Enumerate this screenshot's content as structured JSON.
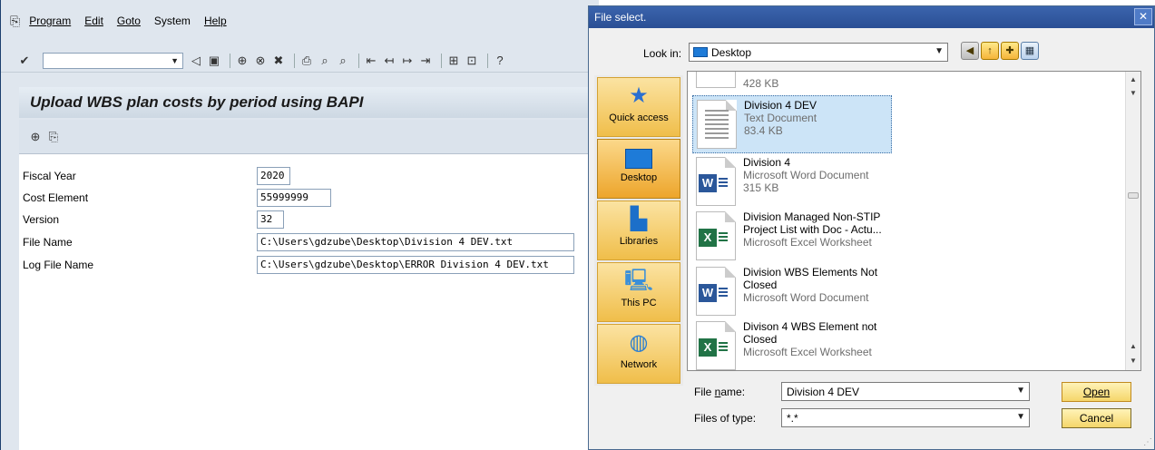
{
  "sap": {
    "menu": [
      "Program",
      "Edit",
      "Goto",
      "System",
      "Help"
    ],
    "title": "Upload WBS plan costs by period using BAPI",
    "fields": [
      {
        "label": "Fiscal Year",
        "value": "2020"
      },
      {
        "label": "Cost Element",
        "value": "55999999"
      },
      {
        "label": "Version",
        "value": "32"
      },
      {
        "label": "File Name",
        "value": "C:\\Users\\gdzube\\Desktop\\Division 4 DEV.txt"
      },
      {
        "label": "Log File Name",
        "value": "C:\\Users\\gdzube\\Desktop\\ERROR Division 4 DEV.txt"
      }
    ],
    "toolbar_icons": [
      "enter-icon",
      "back-icon",
      "save-icon",
      "exit-icon",
      "cancel-icon",
      "print-icon",
      "find-icon",
      "find-next-icon",
      "help-icon"
    ]
  },
  "dialog": {
    "title": "File select.",
    "close": "✕",
    "look_in_label": "Look in:",
    "look_in_value": "Desktop",
    "places": [
      "Quick access",
      "Desktop",
      "Libraries",
      "This PC",
      "Network"
    ],
    "files": [
      {
        "name": "",
        "type": "",
        "size": "428 KB",
        "icon": "text"
      },
      {
        "name": "Division 4 DEV",
        "type": "Text Document",
        "size": "83.4 KB",
        "icon": "text"
      },
      {
        "name": "Division 4",
        "type": "Microsoft Word Document",
        "size": "315 KB",
        "icon": "word"
      },
      {
        "name": "Division Managed Non-STIP Project List with Doc - Actu...",
        "type": "Microsoft Excel Worksheet",
        "size": "",
        "icon": "excel"
      },
      {
        "name": "Division WBS Elements Not Closed",
        "type": "Microsoft Word Document",
        "size": "",
        "icon": "word"
      },
      {
        "name": "Divison 4 WBS Element not Closed",
        "type": "Microsoft Excel Worksheet",
        "size": "",
        "icon": "excel"
      }
    ],
    "file_name_label": "File name:",
    "file_name_value": "Division 4 DEV",
    "file_type_label": "Files of type:",
    "file_type_value": "*.*",
    "open_label": "Open",
    "cancel_label": "Cancel"
  },
  "colors": {
    "sap_bg": "#dfe6ee",
    "dialog_title": "#2a4f95",
    "place_button": "#f0be4a",
    "selection": "#cce4f7"
  }
}
